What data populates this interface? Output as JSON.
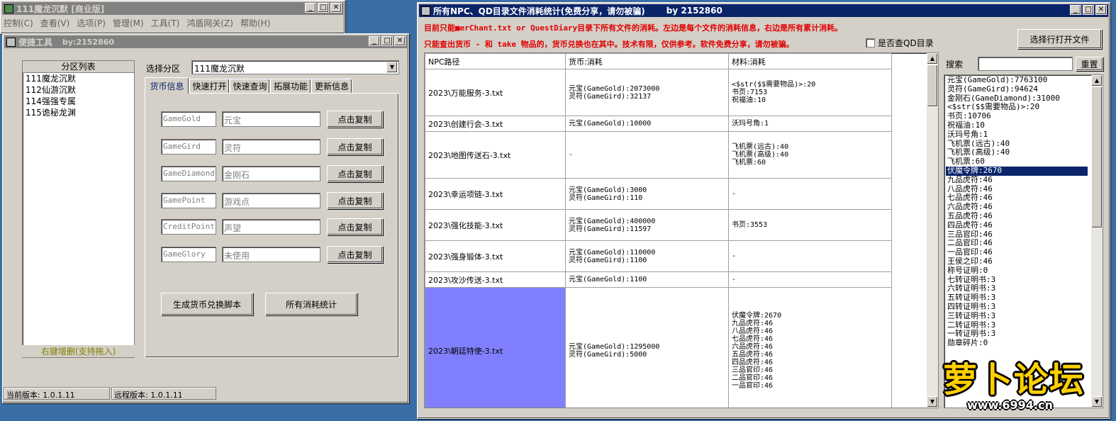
{
  "colors": {
    "titlebar_active": "#0a246a",
    "highlight_row": "#8080ff",
    "notice_red": "#e00000",
    "footer_text": "#808000"
  },
  "back_window": {
    "title": "111魔龙沉默 [商业版]",
    "menu": [
      "控制(C)",
      "查看(V)",
      "选项(P)",
      "管理(M)",
      "工具(T)",
      "鸿盾网关(Z)",
      "帮助(H)"
    ]
  },
  "tool_window": {
    "title": "便捷工具",
    "by": "by:2152860",
    "partition_list_header": "分区列表",
    "partitions": [
      "111魔龙沉默",
      "112仙游沉默",
      "114强强专属",
      "115诡秘龙渊"
    ],
    "partition_footer": "右键增删(支持拖入)",
    "select_label": "选择分区",
    "selected_partition": "111魔龙沉默",
    "tabs": [
      "货币信息",
      "快速打开",
      "快速查询",
      "拓展功能",
      "更新信息"
    ],
    "currencies": [
      {
        "key": "GameGold",
        "name": "元宝",
        "button": "点击复制"
      },
      {
        "key": "GameGird",
        "name": "灵符",
        "button": "点击复制"
      },
      {
        "key": "GameDiamond",
        "name": "金刚石",
        "button": "点击复制"
      },
      {
        "key": "GamePoint",
        "name": "游戏点",
        "button": "点击复制"
      },
      {
        "key": "CreditPoint",
        "name": "声望",
        "button": "点击复制"
      },
      {
        "key": "GameGlory",
        "name": "未使用",
        "button": "点击复制"
      }
    ],
    "btn_generate": "生成货币兑换脚本",
    "btn_stats": "所有消耗统计",
    "status_local": "当前版本: 1.0.1.11",
    "status_remote": "远程版本: 1.0.1.11"
  },
  "stats_window": {
    "title": "所有NPC、QD目录文件消耗统计(免费分享，请勿被骗)",
    "by": "by 2152860",
    "notice1": "目前只能■erChant.txt or QuestDiary目录下所有文件的消耗。左边是每个文件的消耗信息，右边是所有累计消耗。",
    "notice2": "只能查出货币 - 和 take 物品的，货币兑换也在其中。技术有限，仅供参考。软件免费分享，请勿被骗。",
    "checkbox_label": "是否查QD目录",
    "open_button": "选择行打开文件",
    "search_label": "搜索",
    "reset_button": "重置",
    "columns": [
      "NPC路径",
      "货币:消耗",
      "材料:消耗"
    ],
    "rows": [
      {
        "path": "2023\\万能服务-3.txt",
        "currency": [
          "元宝(GameGold):2073000",
          "灵符(GameGird):32137"
        ],
        "material": [
          "<$str($$需要物品)>:20",
          "书页:7153",
          "祝福油:10"
        ]
      },
      {
        "path": "2023\\创建行会-3.txt",
        "currency": [
          "元宝(GameGold):10000"
        ],
        "material": [
          "沃玛号角:1"
        ]
      },
      {
        "path": "2023\\地图传送石-3.txt",
        "currency": [
          "-"
        ],
        "material": [
          "飞机票(远古):40",
          "飞机票(高级):40",
          "飞机票:60"
        ]
      },
      {
        "path": "2023\\幸运项链-3.txt",
        "currency": [
          "元宝(GameGold):3000",
          "灵符(GameGird):110"
        ],
        "material": [
          "-"
        ]
      },
      {
        "path": "2023\\强化技能-3.txt",
        "currency": [
          "元宝(GameGold):400000",
          "灵符(GameGird):11597"
        ],
        "material": [
          "书页:3553"
        ]
      },
      {
        "path": "2023\\强身锻体-3.txt",
        "currency": [
          "元宝(GameGold):110000",
          "灵符(GameGird):1100"
        ],
        "material": [
          "-"
        ]
      },
      {
        "path": "2023\\攻沙传送-3.txt",
        "currency": [
          "元宝(GameGold):1100"
        ],
        "material": [
          "-"
        ]
      },
      {
        "path": "2023\\朝廷特使-3.txt",
        "currency": [
          "元宝(GameGold):1295000",
          "灵符(GameGird):5000"
        ],
        "material": [
          "伏魔令牌:2670",
          "九品虎符:46",
          "八品虎符:46",
          "七品虎符:46",
          "六品虎符:46",
          "五品虎符:46",
          "四品虎符:46",
          "三品官印:46",
          "二品官印:46",
          "一品官印:46"
        ]
      }
    ],
    "totals": [
      "元宝(GameGold):7763100",
      "灵符(GameGird):94624",
      "金刚石(GameDiamond):31000",
      "<$str($$需要物品)>:20",
      "书页:10706",
      "祝福油:10",
      "沃玛号角:1",
      "飞机票(远古):40",
      "飞机票(高级):40",
      "飞机票:60",
      "伏魔令牌:2670",
      "九品虎符:46",
      "八品虎符:46",
      "七品虎符:46",
      "六品虎符:46",
      "五品虎符:46",
      "四品虎符:46",
      "三品官印:46",
      "二品官印:46",
      "一品官印:46",
      "王侯之印:46",
      "称号证明:0",
      "七转证明书:3",
      "六转证明书:3",
      "五转证明书:3",
      "四转证明书:3",
      "三转证明书:3",
      "二转证明书:3",
      "一转证明书:3",
      "勋章碎片:0"
    ],
    "selected_total_index": 10
  },
  "watermark": {
    "brand": "萝卜论坛",
    "url": "www.6994.cn"
  }
}
